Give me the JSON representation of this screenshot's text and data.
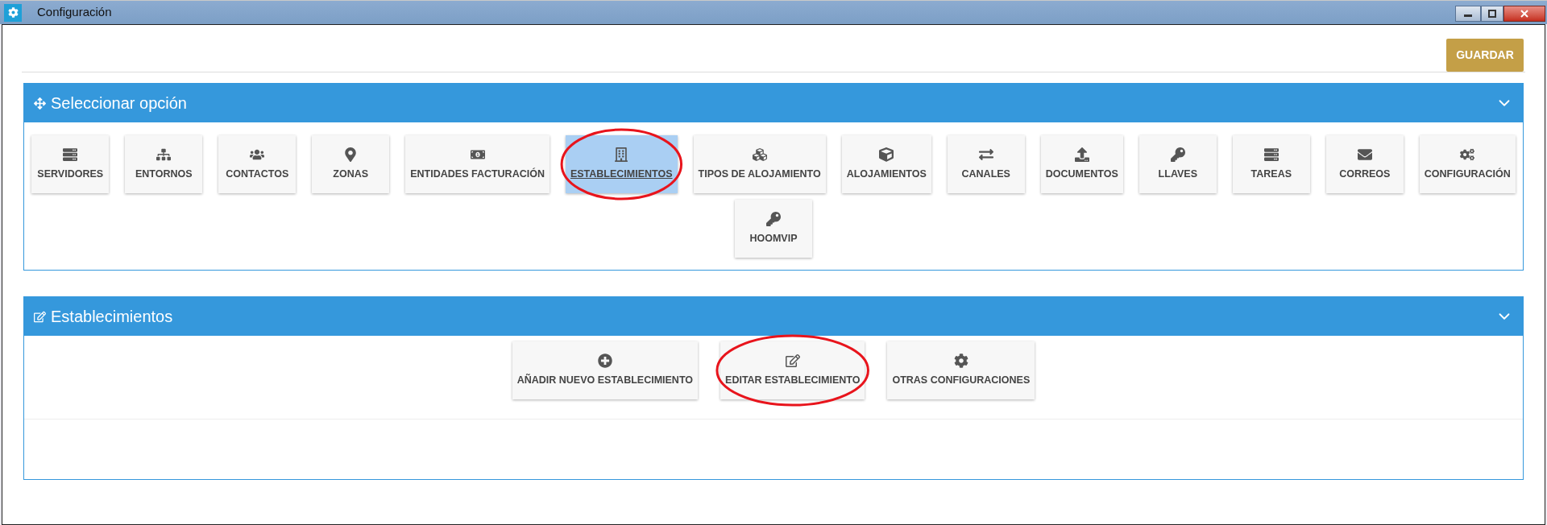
{
  "window": {
    "title": "Configuración"
  },
  "save_button": "GUARDAR",
  "options_panel": {
    "title": "Seleccionar opción",
    "items": [
      {
        "label": "SERVIDORES",
        "selected": false
      },
      {
        "label": "ENTORNOS",
        "selected": false
      },
      {
        "label": "CONTACTOS",
        "selected": false
      },
      {
        "label": "ZONAS",
        "selected": false
      },
      {
        "label": "ENTIDADES FACTURACIÓN",
        "selected": false
      },
      {
        "label": "ESTABLECIMIENTOS",
        "selected": true
      },
      {
        "label": "TIPOS DE ALOJAMIENTO",
        "selected": false
      },
      {
        "label": "ALOJAMIENTOS",
        "selected": false
      },
      {
        "label": "CANALES",
        "selected": false
      },
      {
        "label": "DOCUMENTOS",
        "selected": false
      },
      {
        "label": "LLAVES",
        "selected": false
      },
      {
        "label": "TAREAS",
        "selected": false
      },
      {
        "label": "CORREOS",
        "selected": false
      },
      {
        "label": "CONFIGURACIÓN",
        "selected": false
      },
      {
        "label": "HOOMVIP",
        "selected": false
      }
    ]
  },
  "section_panel": {
    "title": "Establecimientos",
    "items": [
      {
        "label": "AÑADIR NUEVO ESTABLECIMIENTO"
      },
      {
        "label": "EDITAR ESTABLECIMIENTO"
      },
      {
        "label": "OTRAS CONFIGURACIONES"
      }
    ]
  }
}
